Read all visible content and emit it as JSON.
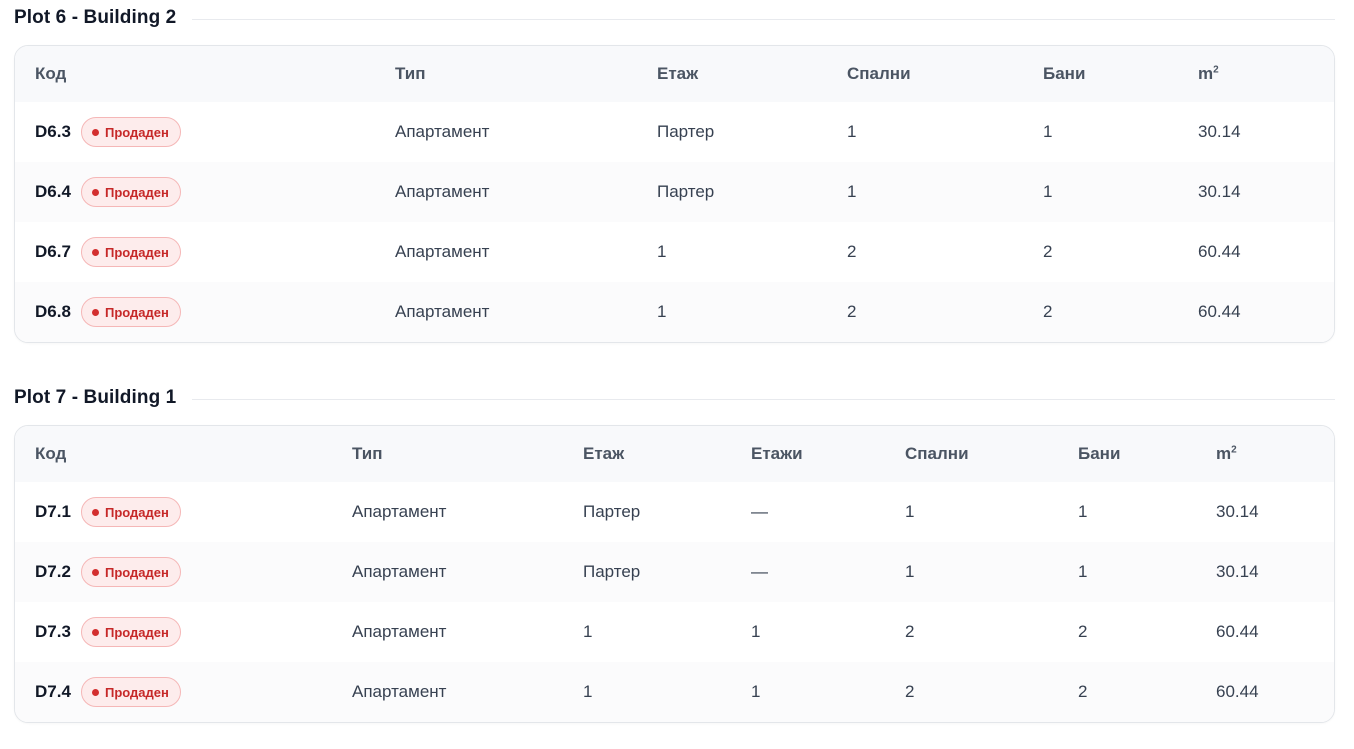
{
  "sections": [
    {
      "title": "Plot 6 - Building 2",
      "columns": [
        "Код",
        "Тип",
        "Етаж",
        "Спални",
        "Бани",
        "m",
        "2"
      ],
      "rows": [
        {
          "code": "D6.3",
          "status": "Продаден",
          "type": "Апартамент",
          "floor": "Партер",
          "bedrooms": "1",
          "baths": "1",
          "area": "30.14"
        },
        {
          "code": "D6.4",
          "status": "Продаден",
          "type": "Апартамент",
          "floor": "Партер",
          "bedrooms": "1",
          "baths": "1",
          "area": "30.14"
        },
        {
          "code": "D6.7",
          "status": "Продаден",
          "type": "Апартамент",
          "floor": "1",
          "bedrooms": "2",
          "baths": "2",
          "area": "60.44"
        },
        {
          "code": "D6.8",
          "status": "Продаден",
          "type": "Апартамент",
          "floor": "1",
          "bedrooms": "2",
          "baths": "2",
          "area": "60.44"
        }
      ]
    },
    {
      "title": "Plot 7 - Building 1",
      "columns": [
        "Код",
        "Тип",
        "Етаж",
        "Етажи",
        "Спални",
        "Бани",
        "m",
        "2"
      ],
      "rows": [
        {
          "code": "D7.1",
          "status": "Продаден",
          "type": "Апартамент",
          "floor": "Партер",
          "floors": "—",
          "bedrooms": "1",
          "baths": "1",
          "area": "30.14"
        },
        {
          "code": "D7.2",
          "status": "Продаден",
          "type": "Апартамент",
          "floor": "Партер",
          "floors": "—",
          "bedrooms": "1",
          "baths": "1",
          "area": "30.14"
        },
        {
          "code": "D7.3",
          "status": "Продаден",
          "type": "Апартамент",
          "floor": "1",
          "floors": "1",
          "bedrooms": "2",
          "baths": "2",
          "area": "60.44"
        },
        {
          "code": "D7.4",
          "status": "Продаден",
          "type": "Апартамент",
          "floor": "1",
          "floors": "1",
          "bedrooms": "2",
          "baths": "2",
          "area": "60.44"
        }
      ]
    }
  ],
  "colors": {
    "badge_bg": "#fdecec",
    "badge_border": "#f5b7b7",
    "badge_text": "#c62828",
    "header_bg": "#f8f9fb"
  }
}
